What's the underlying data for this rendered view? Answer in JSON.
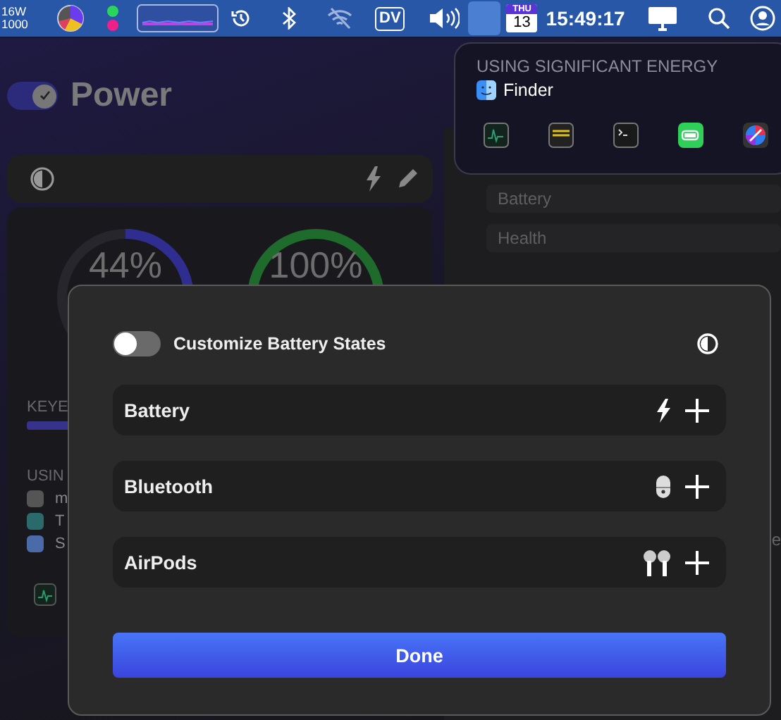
{
  "menu_bar": {
    "power_reading": [
      "16W",
      "1000"
    ],
    "dv_label": "DV",
    "calendar": {
      "weekday": "THU",
      "day": "13"
    },
    "clock": "15:49:17"
  },
  "app": {
    "title": "Power",
    "title_toggle": {
      "on": true
    },
    "gauges": [
      {
        "reading": "44%",
        "level": 0.44,
        "color": "#2f2e90"
      },
      {
        "reading": "100%",
        "level": 1,
        "color": "#1e6b2c"
      }
    ],
    "section_1": "KEYE",
    "section_2": "USIN",
    "section_2_rows": [
      "m",
      "T",
      "S"
    ],
    "fields": [
      "Battery",
      "Health"
    ],
    "edge_text": "e"
  },
  "popover": {
    "heading": "USING SIGNIFICANT ENERGY",
    "app": "Finder"
  },
  "dialog": {
    "toggle": {
      "label": "Customize Battery States",
      "on": false
    },
    "rows": [
      {
        "label": "Battery",
        "kind": "battery"
      },
      {
        "label": "Bluetooth",
        "kind": "bluetooth"
      },
      {
        "label": "AirPods",
        "kind": "airpods"
      }
    ],
    "done": "Done"
  }
}
